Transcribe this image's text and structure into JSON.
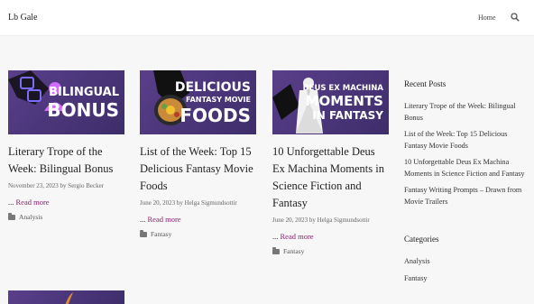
{
  "site": {
    "title": "Lb Gale"
  },
  "nav": {
    "home": "Home"
  },
  "posts": [
    {
      "thumb_lines": [
        "BILINGUAL",
        "BONUS"
      ],
      "title": "Literary Trope of the Week: Bilingual Bonus",
      "date": "November 23, 2023",
      "by": "by",
      "author": "Sergio Becker",
      "prefix": "...",
      "more": "Read more",
      "category": "Analysis"
    },
    {
      "thumb_lines": [
        "DELICIOUS",
        "FANTASY MOVIE",
        "FOODS"
      ],
      "title": "List of the Week: Top 15 Delicious Fantasy Movie Foods",
      "date": "June 20, 2023",
      "by": "by",
      "author": "Helga Sigmundsottir",
      "prefix": "...",
      "more": "Read more",
      "category": "Fantasy"
    },
    {
      "thumb_lines": [
        "DEUS EX MACHINA",
        "MOMENTS",
        "IN FANTASY"
      ],
      "title": "10 Unforgettable Deus Ex Machina Moments in Science Fiction and Fantasy",
      "date": "June 20, 2023",
      "by": "by",
      "author": "Helga Sigmundsottir",
      "prefix": "...",
      "more": "Read more",
      "category": "Fantasy"
    }
  ],
  "sidebar": {
    "recent_title": "Recent Posts",
    "recent": [
      "Literary Trope of the Week: Bilingual Bonus",
      "List of the Week: Top 15 Delicious Fantasy Movie Foods",
      "10 Unforgettable Deus Ex Machina Moments in Science Fiction and Fantasy",
      "Fantasy Writing Prompts – Drawn from Movie Trailers"
    ],
    "categories_title": "Categories",
    "categories": [
      "Analysis",
      "Fantasy"
    ]
  },
  "colors": {
    "accent": "#8b1e6b",
    "thumb": "#4b3779"
  }
}
